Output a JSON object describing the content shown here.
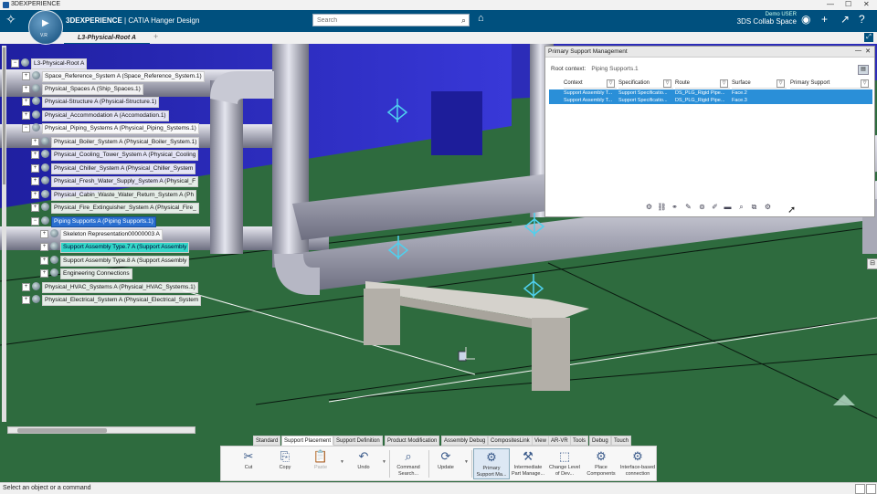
{
  "window": {
    "title": "3DEXPERIENCE",
    "controls": [
      "—",
      "☐",
      "✕"
    ]
  },
  "topbar": {
    "brand_bold": "3DEXPERIENCE",
    "brand_rest": " | CATIA  Hanger Design",
    "compass_version": "V.R",
    "search_placeholder": "Search",
    "user_name": "Demo USER",
    "collab_space": "3DS Collab Space"
  },
  "tabs": {
    "active": "L3-Physical-Root A",
    "add": "+"
  },
  "tree": {
    "nodes": [
      {
        "label": "L3-Physical-Root A",
        "exp": "−"
      },
      {
        "label": "Space_Reference_System A (Space_Reference_System.1)",
        "exp": "+"
      },
      {
        "label": "Physical_Spaces A (Ship_Spaces.1)",
        "exp": "+"
      },
      {
        "label": "Physical-Structure A (Physical-Structure.1)",
        "exp": "+"
      },
      {
        "label": "Physical_Accommodation A (Accomodation.1)",
        "exp": "+"
      },
      {
        "label": "Physical_Piping_Systems A (Physical_Piping_Systems.1)",
        "exp": "−"
      },
      {
        "label": "Physical_Boiler_System A (Physical_Boiler_System.1)",
        "exp": "+"
      },
      {
        "label": "Physical_Cooling_Tower_System A (Physical_Cooling",
        "exp": "+"
      },
      {
        "label": "Physical_Chiller_System A (Physical_Chiller_System",
        "exp": "+"
      },
      {
        "label": "Physical_Fresh_Water_Supply_System A (Physical_F",
        "exp": "+"
      },
      {
        "label": "Physical_Cabin_Waste_Water_Return_System A (Ph",
        "exp": "+"
      },
      {
        "label": "Physical_Fire_Extinguisher_System A (Physical_Fire_",
        "exp": "+"
      },
      {
        "label": "Piping Supports A (Piping Supports.1)",
        "exp": "−"
      },
      {
        "label": "Skeleton Representation00000003 A",
        "exp": "+"
      },
      {
        "label": "Support Assembly Type.7 A (Support Assembly",
        "exp": "+"
      },
      {
        "label": "Support Assembly Type.8 A (Support Assembly",
        "exp": "+"
      },
      {
        "label": "Engineering Connections",
        "exp": "+"
      },
      {
        "label": "Physical_HVAC_Systems A (Physical_HVAC_Systems.1)",
        "exp": "+"
      },
      {
        "label": "Physical_Electrical_System A (Physical_Electrical_System",
        "exp": "+"
      }
    ]
  },
  "panel": {
    "title": "Primary Support Management",
    "root_context_label": "Root context:",
    "root_context_value": "Piping Supports.1",
    "columns": [
      "Context",
      "Specification",
      "Route",
      "Surface",
      "Primary Support"
    ],
    "rows": [
      [
        "Support Assembly T...",
        "Support Specificatio...",
        "DS_PLG_Rigid Pipe...",
        "Face.2",
        ""
      ],
      [
        "Support Assembly T...",
        "Support Specificatio...",
        "DS_PLG_Rigid Pipe...",
        "Face.3",
        ""
      ]
    ]
  },
  "actionbar": {
    "tabs": [
      "Standard",
      "Support Placement",
      "Support Definition",
      "Product Modification",
      "Assembly Debug",
      "CompositesLink",
      "View",
      "AR-VR",
      "Tools",
      "Debug",
      "Touch"
    ],
    "active_tab": "Support Placement",
    "tools": [
      {
        "label": "Cut",
        "icon": "✂"
      },
      {
        "label": "Copy",
        "icon": "⎘"
      },
      {
        "label": "Paste",
        "icon": "📋"
      },
      {
        "label": "Undo",
        "icon": "↶"
      },
      {
        "label": "Command Search...",
        "icon": "⌕"
      },
      {
        "label": "Update",
        "icon": "⟳"
      },
      {
        "label": "Primary Support Ma...",
        "icon": "⚙"
      },
      {
        "label": "Intermediate Part Manage...",
        "icon": "⚒"
      },
      {
        "label": "Change Level of Dev...",
        "icon": "⬚"
      },
      {
        "label": "Place Components",
        "icon": "⚙"
      },
      {
        "label": "Interface-based connection",
        "icon": "⚙"
      }
    ]
  },
  "status": {
    "text": "Select an object or a command"
  },
  "colors": {
    "topbar": "#00507e",
    "ground": "#2e6b3e",
    "selection": "#2a6fd0",
    "highlight": "#33d6c8"
  }
}
